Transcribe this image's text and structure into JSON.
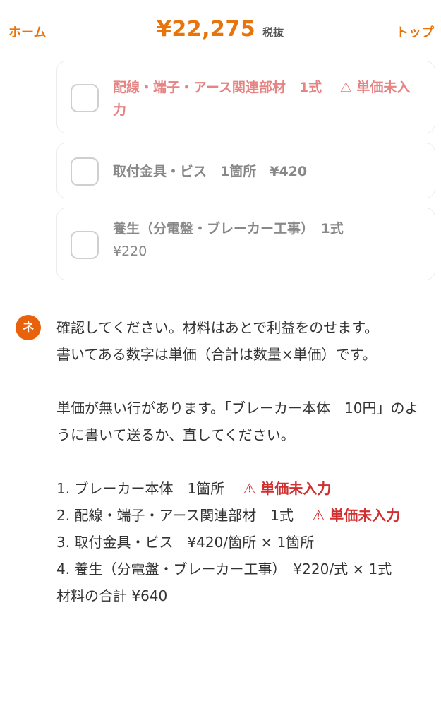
{
  "header": {
    "home_label": "ホーム",
    "top_label": "トップ",
    "total_amount": "¥22,275",
    "total_tax_label": "税抜"
  },
  "items": [
    {
      "name": "配線・端子・アース関連部材　1式",
      "warning": "⚠ 単価未入力",
      "checked": false,
      "status_color": "#e68383"
    },
    {
      "name": "取付金具・ビス　1箇所　¥420",
      "checked": false
    },
    {
      "name": "養生（分電盤・ブレーカー工事）　1式",
      "price": "¥220",
      "checked": false
    }
  ],
  "chat": {
    "avatar_label": "ネ",
    "line1": "確認してください。材料はあとで利益をのせます。",
    "line2": "書いてある数字は単価（合計は数量×単価）です。",
    "line3": "単価が無い行があります。「ブレーカー本体　10円」のように書いて送るか、直してください。",
    "list": [
      {
        "text": "1. ブレーカー本体　1箇所　",
        "warning": "⚠ 単価未入力"
      },
      {
        "text": "2. 配線・端子・アース関連部材　1式　",
        "warning": "⚠ 単価未入力"
      },
      {
        "text": "3. 取付金具・ビス　¥420/箇所 × 1箇所"
      },
      {
        "text": "4. 養生（分電盤・ブレーカー工事）　¥220/式 × 1式"
      }
    ],
    "material_total": "材料の合計 ¥640"
  },
  "colors": {
    "accent": "#e8740c",
    "avatar": "#e8620e",
    "warning": "#d12f2f"
  }
}
